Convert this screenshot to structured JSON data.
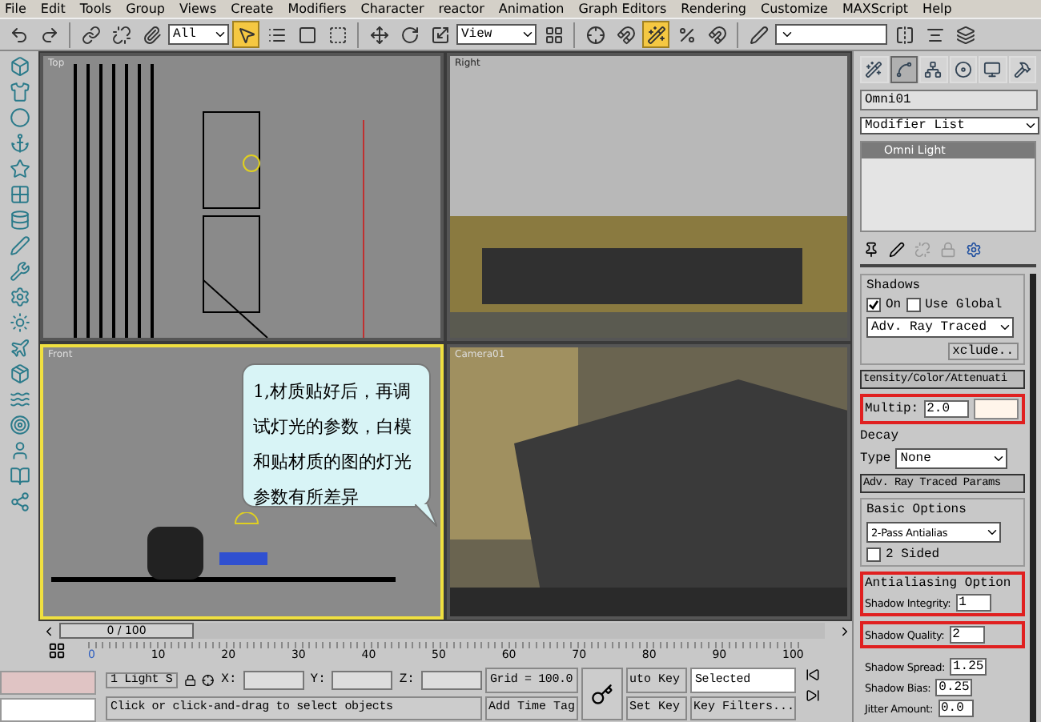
{
  "menu": [
    "File",
    "Edit",
    "Tools",
    "Group",
    "Views",
    "Create",
    "Modifiers",
    "Character",
    "reactor",
    "Animation",
    "Graph Editors",
    "Rendering",
    "Customize",
    "MAXScript",
    "Help"
  ],
  "toolbar": [
    {
      "kind": "icon",
      "active": false
    },
    {
      "kind": "icon",
      "active": false
    },
    {
      "kind": "sep"
    },
    {
      "kind": "icon",
      "active": false
    },
    {
      "kind": "icon",
      "active": false
    },
    {
      "kind": "icon",
      "active": false
    },
    {
      "kind": "dropdown",
      "value": "All"
    },
    {
      "kind": "icon",
      "active": true
    },
    {
      "kind": "icon",
      "active": false
    },
    {
      "kind": "icon",
      "active": false
    },
    {
      "kind": "icon",
      "active": false
    },
    {
      "kind": "sep"
    },
    {
      "kind": "icon",
      "active": false
    },
    {
      "kind": "icon",
      "active": false
    },
    {
      "kind": "icon",
      "active": false
    },
    {
      "kind": "dropdown",
      "value": "View"
    },
    {
      "kind": "icon",
      "active": false
    },
    {
      "kind": "sep"
    },
    {
      "kind": "icon",
      "active": false
    },
    {
      "kind": "icon",
      "active": false
    },
    {
      "kind": "icon",
      "active": true
    },
    {
      "kind": "icon",
      "active": false
    },
    {
      "kind": "icon",
      "active": false
    },
    {
      "kind": "sep"
    },
    {
      "kind": "icon",
      "active": false
    },
    {
      "kind": "dropdown"
    },
    {
      "kind": "icon",
      "active": false
    },
    {
      "kind": "icon",
      "active": false
    },
    {
      "kind": "icon",
      "active": false
    }
  ],
  "viewports": [
    {
      "label": "Top",
      "kind": "top",
      "active": false
    },
    {
      "label": "Right",
      "kind": "right",
      "active": false
    },
    {
      "label": "Front",
      "kind": "front",
      "active": true
    },
    {
      "label": "Camera01",
      "kind": "camera",
      "active": false
    }
  ],
  "callout": {
    "text": "1,材质贴好后，再调试灯光的参数，白模和贴材质的图的灯光参数有所差异"
  },
  "time_slider": {
    "label": "0 / 100",
    "level": 0
  },
  "track_bar": {
    "ticks": [
      "0",
      "10",
      "20",
      "30",
      "40",
      "50",
      "60",
      "70",
      "80",
      "90",
      "100"
    ]
  },
  "status": {
    "selection": "1 Light S",
    "x_label": "X:",
    "y_label": "Y:",
    "z_label": "Z:",
    "grid": "Grid = 100.0",
    "auto_key": "uto Key",
    "set_key": "Set Key",
    "key_mode": "Selected",
    "key_filters": "Key Filters...",
    "prompt": "Click or click-and-drag to select objects",
    "time_tag": "Add Time Tag"
  },
  "command_panel": {
    "tabs": [
      {
        "selected": false
      },
      {
        "selected": true
      },
      {
        "selected": false
      },
      {
        "selected": false
      },
      {
        "selected": false
      },
      {
        "selected": false
      }
    ],
    "object_name": "Omni01",
    "modifier_list": "Modifier List",
    "stack": [
      {
        "label": "Omni Light",
        "selected": true
      }
    ],
    "shadows": {
      "title": "Shadows",
      "on": {
        "label": "On",
        "checked": true
      },
      "use_global": {
        "label": "Use Global",
        "checked": false
      },
      "type": "Adv. Ray Traced",
      "exclude": "xclude.."
    },
    "intensity": {
      "title": "tensity/Color/Attenuati",
      "multiplier_label": "Multip:",
      "multiplier": "2.0",
      "decay": "Decay",
      "type_label": "Type",
      "type": "None"
    },
    "adv": {
      "title": "Adv. Ray Traced Params",
      "basic": "Basic Options",
      "mode": "2-Pass Antialias",
      "two_sided": {
        "label": "2 Sided",
        "checked": false
      },
      "aa_title": "Antialiasing Option",
      "groups": [
        {
          "highlighted": true,
          "params": [
            {
              "label": "Shadow Integrity:",
              "value": "1"
            }
          ]
        },
        {
          "highlighted": true,
          "params": [
            {
              "label": "Shadow Quality:",
              "value": "2"
            }
          ]
        },
        {
          "highlighted": false,
          "params": [
            {
              "label": "Shadow Spread:",
              "value": "1.25"
            },
            {
              "label": "Shadow Bias:",
              "value": "0.25"
            },
            {
              "label": "Jitter Amount:",
              "value": "0.0"
            }
          ]
        }
      ]
    }
  }
}
